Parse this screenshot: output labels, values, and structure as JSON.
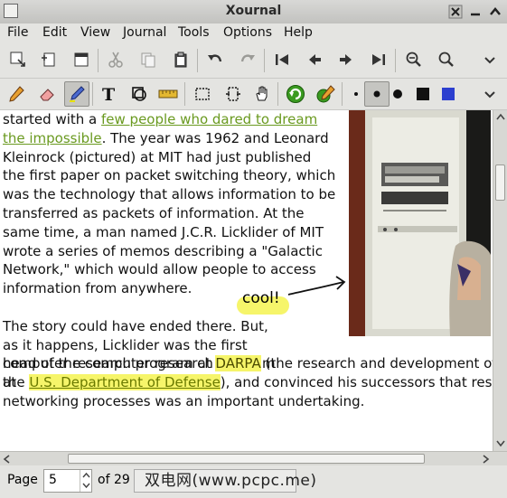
{
  "window": {
    "title": "Xournal"
  },
  "menu": [
    "File",
    "Edit",
    "View",
    "Journal",
    "Tools",
    "Options",
    "Help"
  ],
  "toolbar1_icons": [
    "save-icon",
    "new-page-icon",
    "duplicate-page-icon",
    "cut-icon",
    "copy-icon",
    "paste-icon",
    "undo-icon",
    "redo-icon",
    "first-page-icon",
    "previous-page-icon",
    "next-page-icon",
    "last-page-icon",
    "zoom-out-icon",
    "zoom-in-icon",
    "overflow-chevron-icon"
  ],
  "toolbar2_icons": [
    "pen-icon",
    "eraser-icon",
    "highlighter-icon",
    "text-tool-icon",
    "shape-recognizer-icon",
    "ruler-icon",
    "select-rectangle-icon",
    "select-region-icon",
    "hand-tool-icon",
    "default-tools-icon",
    "default-pen-icon",
    "thickness-fine-icon",
    "thickness-medium-icon",
    "thickness-thick-icon",
    "color-black-icon",
    "color-blue-icon",
    "overflow-chevron-icon"
  ],
  "colors": {
    "accent_link": "#6a9a20",
    "highlight": "#f6f56a",
    "pen_blue": "#2c3fcf"
  },
  "document": {
    "para1_lead": "started with a ",
    "para1_link": "few people who dared to dream the impossible",
    "para1_rest": ". The year was 1962 and Leonard Kleinrock (pictured) at MIT had just published the first paper on packet switching theory, which was the technology that allows information to be transferred as packets of information. At the same time, a man named J.C.R. Licklider of MIT wrote a series of memos describing a \"Galactic Network,\" which would allow people to access information from anywhere.",
    "para2_a": "The story could have ended there. But, as it happens, Licklider was the first head of the computer research program at ",
    "para2_darpa": "DARPA",
    "para2_b": " (the research and development office) ...",
    "para2_c": "the ",
    "para2_dod": "U.S. Department of Defense",
    "para2_d": "), and convinced his successors that research in networking processes was an important undertaking.",
    "annotation": "cool!"
  },
  "status": {
    "page_label": "Page",
    "page_value": "5",
    "of_label": "of 29",
    "watermark": "双电网(www.pcpc.me)"
  }
}
